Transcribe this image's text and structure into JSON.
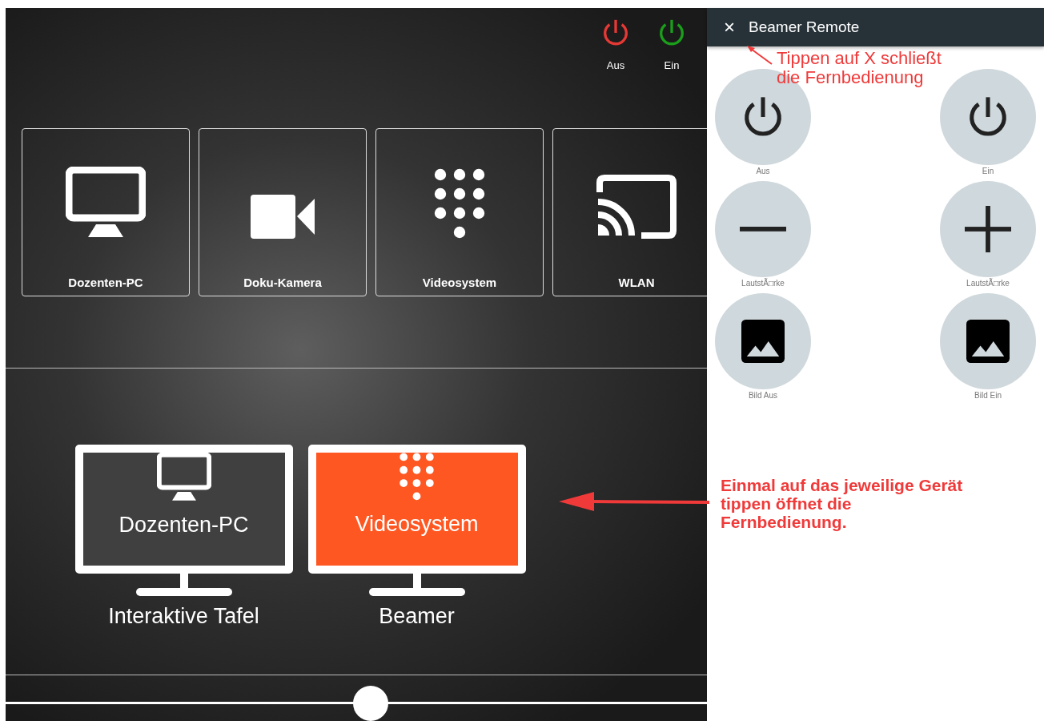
{
  "power": [
    {
      "label": "Aus",
      "kind": "off"
    },
    {
      "label": "Ein",
      "kind": "on"
    }
  ],
  "sources": [
    {
      "label": "Dozenten-PC",
      "kind": "monitor"
    },
    {
      "label": "Doku-Kamera",
      "kind": "camera"
    },
    {
      "label": "Videosystem",
      "kind": "keypad"
    },
    {
      "label": "WLAN",
      "kind": "cast"
    }
  ],
  "displays": [
    {
      "screen_label": "Dozenten-PC",
      "kind": "monitor",
      "name": "Interaktive Tafel",
      "selected": false
    },
    {
      "screen_label": "Videosystem",
      "kind": "keypad",
      "name": "Beamer",
      "selected": true
    }
  ],
  "slider": {
    "level": 0.52
  },
  "remote": {
    "title": "Beamer Remote",
    "close": "×",
    "buttons": [
      {
        "label": "Aus",
        "kind": "power"
      },
      {
        "label": "Ein",
        "kind": "power"
      },
      {
        "label": "LautstÃ□rke",
        "kind": "minus"
      },
      {
        "label": "LautstÃ□rke",
        "kind": "plus"
      },
      {
        "label": "Bild Aus",
        "kind": "image"
      },
      {
        "label": "Bild Ein",
        "kind": "image"
      }
    ]
  },
  "annotations": [
    {
      "lines": [
        "Tippen auf X schließt",
        "die Fernbedienung"
      ]
    },
    {
      "lines": [
        "Einmal auf das jeweilige Gerät",
        "tippen öffnet die",
        "Fernbedienung."
      ]
    }
  ]
}
